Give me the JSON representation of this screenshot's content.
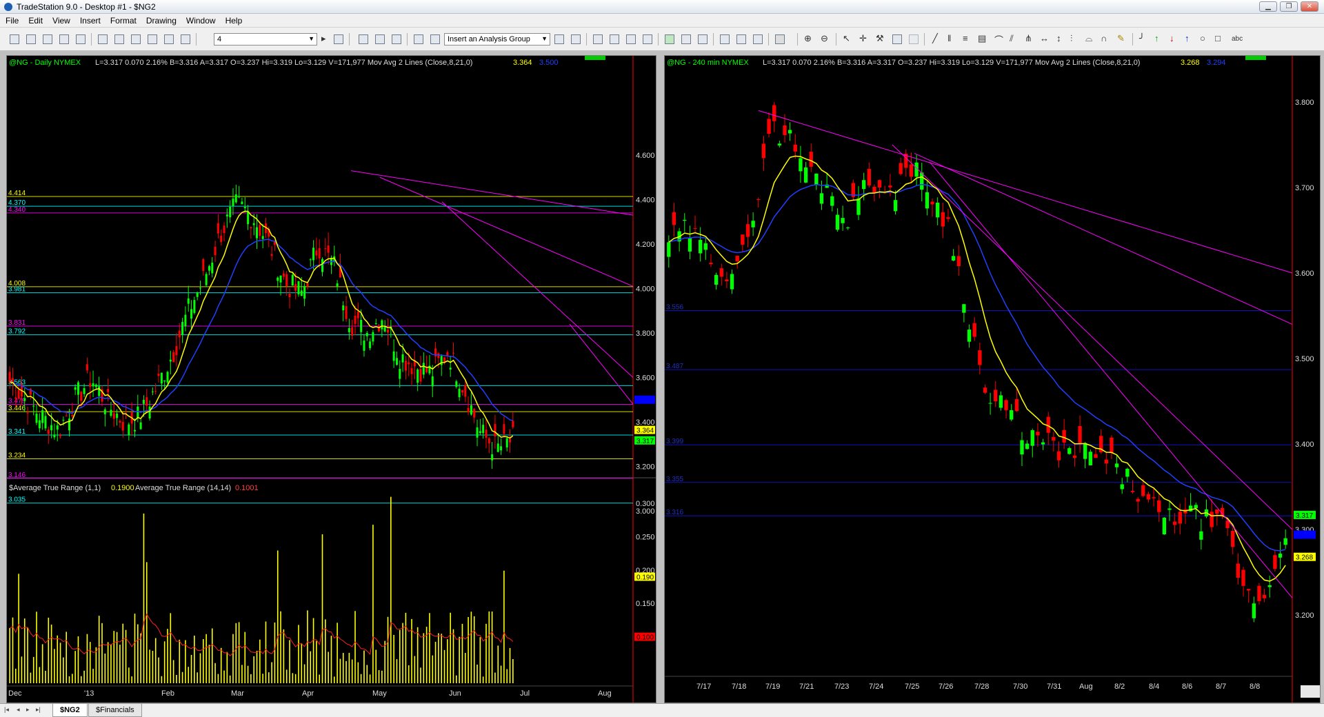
{
  "window": {
    "title": "TradeStation 9.0 - Desktop #1 - $NG2",
    "controls": [
      "▁",
      "❐",
      "✕"
    ]
  },
  "menu": [
    "File",
    "Edit",
    "View",
    "Insert",
    "Format",
    "Drawing",
    "Window",
    "Help"
  ],
  "toolbar": {
    "symbol_combo": "4",
    "analysis_combo": "Insert an Analysis Group"
  },
  "left_chart": {
    "header": {
      "symbol": "@NG - Daily  NYMEX",
      "stats": "L=3.317  0.070   2.16%    B=3.316  A=3.317  O=3.237  Hi=3.319  Lo=3.129  V=171,977  Mov Avg 2 Lines (Close,8,21,0)",
      "ma_fast": "3.364",
      "ma_slow": "3.500"
    },
    "price_axis": [
      "4.600",
      "4.400",
      "4.200",
      "4.000",
      "3.800",
      "3.600",
      "3.400",
      "3.200",
      "3.000"
    ],
    "date_axis": [
      "Dec",
      "'13",
      "Feb",
      "Mar",
      "Apr",
      "May",
      "Jun",
      "Jul",
      "Aug"
    ],
    "level_labels": [
      {
        "text": "4.414",
        "price": 4.414,
        "color": "#ffff00"
      },
      {
        "text": "4.370",
        "price": 4.37,
        "color": "#00ffff"
      },
      {
        "text": "4.340",
        "price": 4.34,
        "color": "#ff00ff"
      },
      {
        "text": "4.008",
        "price": 4.008,
        "color": "#ffff00"
      },
      {
        "text": "3.981",
        "price": 3.981,
        "color": "#00ffff"
      },
      {
        "text": "3.831",
        "price": 3.831,
        "color": "#ff00ff"
      },
      {
        "text": "3.792",
        "price": 3.792,
        "color": "#00ffff"
      },
      {
        "text": "3.563",
        "price": 3.563,
        "color": "#00ffff"
      },
      {
        "text": "3.479",
        "price": 3.479,
        "color": "#ff00ff"
      },
      {
        "text": "3.446",
        "price": 3.446,
        "color": "#ffff00"
      },
      {
        "text": "3.341",
        "price": 3.341,
        "color": "#00ffff"
      },
      {
        "text": "3.234",
        "price": 3.234,
        "color": "#ffff00"
      },
      {
        "text": "3.146",
        "price": 3.146,
        "color": "#ff00ff"
      },
      {
        "text": "3.035",
        "price": 3.035,
        "color": "#00ffff"
      }
    ],
    "price_tags": [
      {
        "text": "3.364",
        "price": 3.364,
        "bg": "#ffff00",
        "fg": "#000000"
      },
      {
        "text": "3.317",
        "price": 3.317,
        "bg": "#00ff00",
        "fg": "#000000"
      },
      {
        "text": "3.500",
        "price": 3.5,
        "bg": "#0000ff",
        "fg": "#0000ff"
      }
    ],
    "atr": {
      "label": "$Average True Range (1,1)",
      "value1": "0.1900",
      "label2": "Average True Range (14,14)",
      "value2": "0.1001",
      "axis": [
        "0.300",
        "0.250",
        "0.200",
        "0.150"
      ],
      "tags": [
        {
          "text": "0.190",
          "value": 0.19,
          "bg": "#ffff00"
        },
        {
          "text": "0.100",
          "value": 0.1,
          "bg": "#ff0000"
        }
      ]
    }
  },
  "right_chart": {
    "header": {
      "symbol": "@NG - 240 min  NYMEX",
      "stats": "L=3.317  0.070   2.16%    B=3.316  A=3.317  O=3.237  Hi=3.319  Lo=3.129  V=171,977  Mov Avg 2 Lines (Close,8,21,0)",
      "ma_fast": "3.268",
      "ma_slow": "3.294"
    },
    "price_axis": [
      "3.800",
      "3.700",
      "3.600",
      "3.500",
      "3.400",
      "3.300",
      "3.200"
    ],
    "date_axis": [
      "7/17",
      "7/18",
      "7/19",
      "7/21",
      "7/23",
      "7/24",
      "7/25",
      "7/26",
      "7/28",
      "7/30",
      "7/31",
      "Aug",
      "8/2",
      "8/4",
      "8/6",
      "8/7",
      "8/8"
    ],
    "level_labels": [
      {
        "text": "3.556",
        "price": 3.556
      },
      {
        "text": "3.487",
        "price": 3.487
      },
      {
        "text": "3.399",
        "price": 3.399
      },
      {
        "text": "3.355",
        "price": 3.355
      },
      {
        "text": "3.316",
        "price": 3.316
      }
    ],
    "price_tags": [
      {
        "text": "3.317",
        "price": 3.317,
        "bg": "#00ff00",
        "fg": "#000000"
      },
      {
        "text": "3.294",
        "price": 3.294,
        "bg": "#0000ff",
        "fg": "#0000ff"
      },
      {
        "text": "3.268",
        "price": 3.268,
        "bg": "#ffff00",
        "fg": "#000000"
      }
    ]
  },
  "tabs": [
    {
      "label": "$NG2",
      "active": true
    },
    {
      "label": "$Financials",
      "active": false
    }
  ],
  "colors": {
    "up": "#00ff00",
    "down": "#ff0000",
    "ma_fast": "#ffff00",
    "ma_slow": "#2040ff",
    "trendline": "#ff00ff"
  }
}
